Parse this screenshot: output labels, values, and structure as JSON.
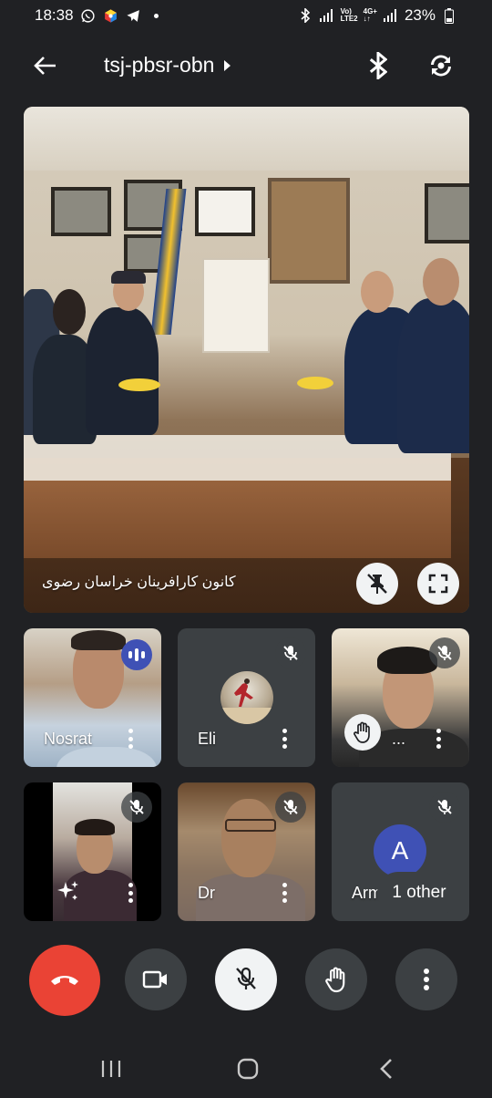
{
  "status_bar": {
    "time": "18:38",
    "network_label_top": "Vo)",
    "network_label_bottom": "LTE2",
    "network_type": "4G+",
    "battery_percent": "23%"
  },
  "header": {
    "meeting_code": "tsj-pbsr-obn"
  },
  "main_video": {
    "caption": "کانون کارافرینان خراسان رضوی"
  },
  "participants": [
    {
      "name": "Nosrat",
      "state": "speaking"
    },
    {
      "name": "Eli",
      "state": "muted"
    },
    {
      "name": "...",
      "state": "muted",
      "hand_raised": true
    },
    {
      "name": "",
      "state": "muted"
    },
    {
      "name": "Dr",
      "state": "muted"
    },
    {
      "name": "Armin",
      "avatar_letter": "A",
      "state": "muted"
    }
  ],
  "others_chip": "1 other",
  "colors": {
    "background": "#202124",
    "end_call": "#ea4335",
    "tile": "#3c4043",
    "avatar": "#3f51b5",
    "speaking": "#3f51b5"
  }
}
